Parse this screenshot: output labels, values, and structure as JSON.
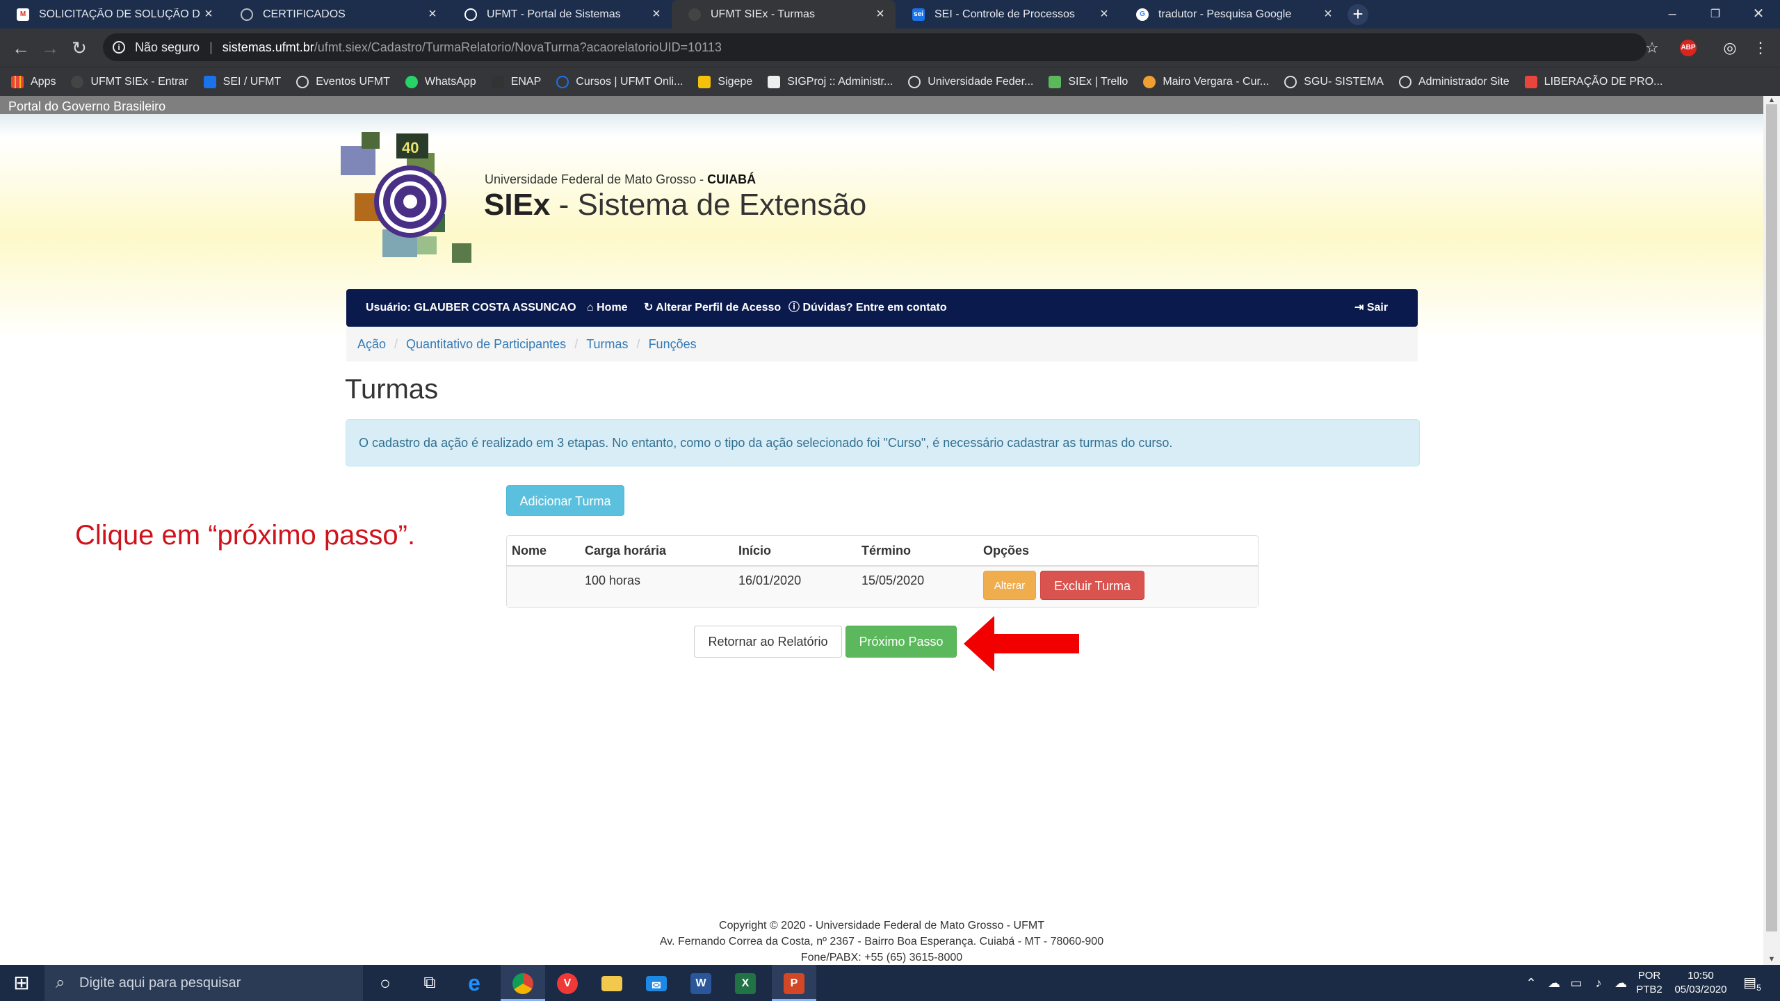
{
  "browser": {
    "tabs": [
      {
        "title": "SOLICITAÇÃO DE SOLUÇÃO DE P",
        "icon": "gmail-icon"
      },
      {
        "title": "CERTIFICADOS",
        "icon": "globe-icon"
      },
      {
        "title": "UFMT - Portal de Sistemas",
        "icon": "globe-icon"
      },
      {
        "title": "UFMT SIEx - Turmas",
        "icon": "globe-icon"
      },
      {
        "title": "SEI - Controle de Processos",
        "icon": "sei-icon"
      },
      {
        "title": "tradutor - Pesquisa Google",
        "icon": "google-icon"
      }
    ],
    "close_glyph": "×",
    "address": {
      "security_label": "Não seguro",
      "host": "sistemas.ufmt.br",
      "path": "/ufmt.siex/Cadastro/TurmaRelatorio/NovaTurma?acaorelatorioUID=10113"
    },
    "extension_badge": "ABP",
    "bookmarks": [
      {
        "label": "Apps",
        "color": "#e8453c"
      },
      {
        "label": "UFMT SIEx - Entrar",
        "color": "#444"
      },
      {
        "label": "SEI / UFMT",
        "color": "#1a73e8"
      },
      {
        "label": "Eventos UFMT",
        "color": "#ddd"
      },
      {
        "label": "WhatsApp",
        "color": "#25d366"
      },
      {
        "label": "ENAP",
        "color": "#333"
      },
      {
        "label": "Cursos | UFMT Onli...",
        "color": "#1a73e8"
      },
      {
        "label": "Sigepe",
        "color": "#f4c20d"
      },
      {
        "label": "SIGProj :: Administr...",
        "color": "#eee"
      },
      {
        "label": "Universidade Feder...",
        "color": "#ddd"
      },
      {
        "label": "SIEx | Trello",
        "color": "#5cb85c"
      },
      {
        "label": "Mairo Vergara - Cur...",
        "color": "#f0a030"
      },
      {
        "label": "SGU- SISTEMA",
        "color": "#ddd"
      },
      {
        "label": "Administrador Site",
        "color": "#ddd"
      },
      {
        "label": "LIBERAÇÃO DE PRO...",
        "color": "#e8453c"
      }
    ]
  },
  "page": {
    "gov_bar": "Portal do Governo Brasileiro",
    "university_prefix": "Universidade Federal de Mato Grosso - ",
    "university_city": "CUIABÁ",
    "system_short": "SIEx",
    "system_rest": " - Sistema de Extensão",
    "logo_badge": "40",
    "nav": {
      "user_label": "Usuário:",
      "user_name": " GLAUBER COSTA ASSUNCAO",
      "home": "Home",
      "profile": "Alterar Perfil de Acesso",
      "help": "Dúvidas? Entre em contato",
      "logout": "Sair"
    },
    "breadcrumbs": [
      "Ação",
      "Quantitativo de Participantes",
      "Turmas",
      "Funções"
    ],
    "breadcrumb_sep": "/",
    "heading": "Turmas",
    "alert": "O cadastro da ação é realizado em 3 etapas. No entanto, como o tipo da ação selecionado foi \"Curso\", é necessário cadastrar as turmas do curso.",
    "add_button": "Adicionar Turma",
    "table": {
      "headers": [
        "Nome",
        "Carga horária",
        "Início",
        "Término",
        "Opções"
      ],
      "rows": [
        {
          "nome": "",
          "carga": "100 horas",
          "inicio": "16/01/2020",
          "termino": "15/05/2020",
          "edit": "Alterar",
          "delete": "Excluir Turma"
        }
      ]
    },
    "back_button": "Retornar ao Relatório",
    "next_button": "Próximo Passo",
    "instruction": "Clique em “próximo passo”.",
    "footer": [
      "Copyright © 2020 - Universidade Federal de Mato Grosso - UFMT",
      "Av. Fernando Correa da Costa, nº 2367 - Bairro Boa Esperança. Cuiabá - MT - 78060-900",
      "Fone/PABX: +55 (65) 3615-8000"
    ]
  },
  "taskbar": {
    "search_placeholder": "Digite aqui para pesquisar",
    "lang_top": "POR",
    "lang_bottom": "PTB2",
    "time": "10:50",
    "date": "05/03/2020",
    "notifications": "5"
  },
  "colors": {
    "accent_navbar": "#0b1a4d",
    "next_button": "#5cb85c",
    "annotation": "#d0121b"
  }
}
